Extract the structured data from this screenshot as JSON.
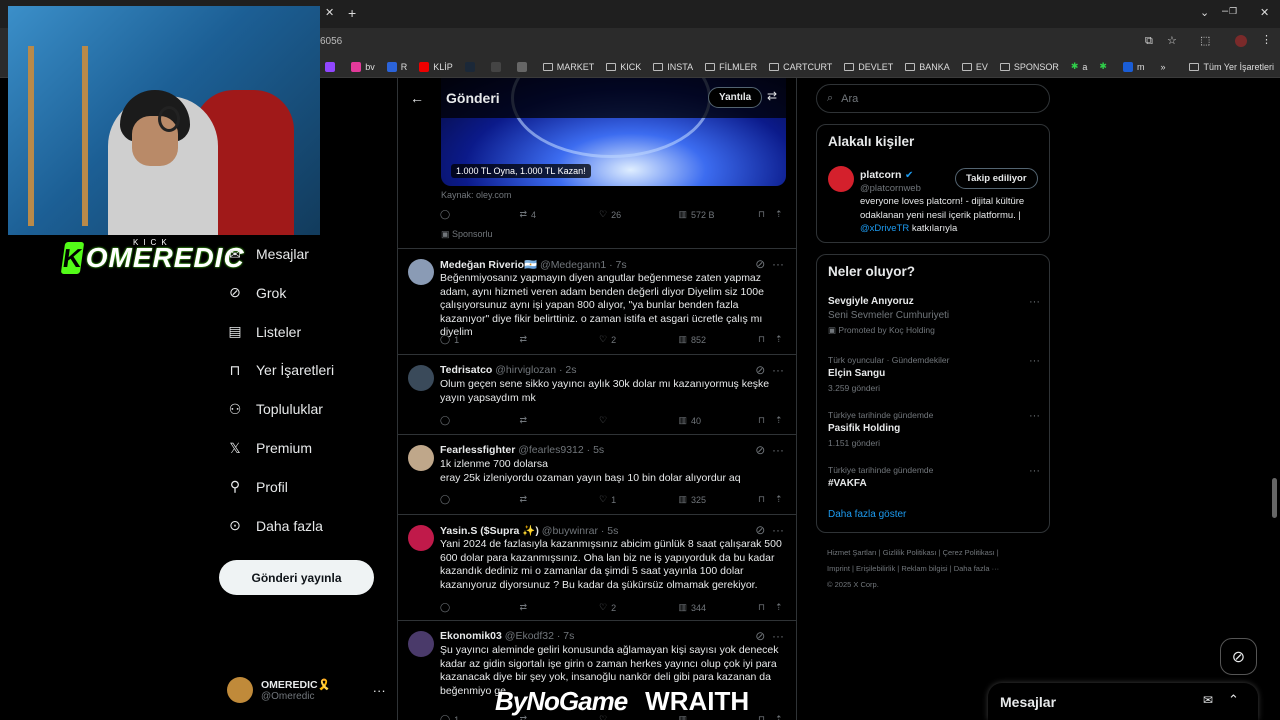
{
  "browser": {
    "address_text": "6056",
    "bookmarks": [
      {
        "label": "R",
        "icon": "none"
      },
      {
        "label": "",
        "icon": "purple-square-icon"
      },
      {
        "label": "KL",
        "icon": "star-icon"
      },
      {
        "label": "",
        "icon": "twitch-icon"
      },
      {
        "label": "bv",
        "icon": "pink-icon"
      },
      {
        "label": "R",
        "icon": "blue-circle-icon"
      },
      {
        "label": "KLİP",
        "icon": "youtube-icon"
      },
      {
        "label": "",
        "icon": "steam-icon"
      },
      {
        "label": "",
        "icon": "tile-icon"
      },
      {
        "label": "",
        "icon": "gear-icon"
      },
      {
        "label": "MARKET",
        "icon": "folder-icon"
      },
      {
        "label": "KICK",
        "icon": "folder-icon"
      },
      {
        "label": "INSTA",
        "icon": "folder-icon"
      },
      {
        "label": "FİLMLER",
        "icon": "folder-icon"
      },
      {
        "label": "CARTCURT",
        "icon": "folder-icon"
      },
      {
        "label": "DEVLET",
        "icon": "folder-icon"
      },
      {
        "label": "BANKA",
        "icon": "folder-icon"
      },
      {
        "label": "EV",
        "icon": "folder-icon"
      },
      {
        "label": "SPONSOR",
        "icon": "folder-icon"
      },
      {
        "label": "a",
        "icon": "green-star-icon"
      },
      {
        "label": "",
        "icon": "green-star-icon"
      },
      {
        "label": "m",
        "icon": "blue-m-icon"
      }
    ],
    "more_label": "»",
    "all_bookmarks": "Tüm Yer İşaretleri"
  },
  "overlay": {
    "kick_small": "KICK",
    "kick_channel": "OMEREDIC",
    "sponsors": [
      "ByNoGame",
      "WRAITH"
    ]
  },
  "nav": {
    "items": [
      {
        "label": "Mesajlar",
        "icon": "mail-icon"
      },
      {
        "label": "Grok",
        "icon": "grok-icon"
      },
      {
        "label": "Listeler",
        "icon": "list-icon"
      },
      {
        "label": "Yer İşaretleri",
        "icon": "bookmark-icon"
      },
      {
        "label": "Topluluklar",
        "icon": "communities-icon"
      },
      {
        "label": "Premium",
        "icon": "x-logo-icon"
      },
      {
        "label": "Profil",
        "icon": "person-icon"
      },
      {
        "label": "Daha fazla",
        "icon": "more-circle-icon"
      }
    ],
    "post_button": "Gönderi yayınla",
    "user_name": "OMEREDIC🎗️",
    "user_handle": "@Omeredic"
  },
  "main": {
    "title": "Gönderi",
    "reply_button": "Yantıla",
    "ad": {
      "caption": "1.000 TL Oyna, 1.000 TL Kazan!",
      "source": "Kaynak: oley.com",
      "stats": {
        "reposts": "4",
        "likes": "26",
        "views": "572 B"
      },
      "sponsored": "Sponsorlu"
    },
    "tweets": [
      {
        "name": "Medeğan Riverio🇦🇷",
        "handle": "@Medegann1 · 7s",
        "text": "Beğenmiyosanız yapmayın diyen angutlar beğenmese zaten yapmaz adam, aynı hizmeti veren adam benden değerli diyor Diyelim siz 100e çalışıyorsunuz aynı işi yapan 800 alıyor, \"ya bunlar benden fazla kazanıyor\" diye fikir belirttiniz. o zaman istifa et asgari ücretle çalış mı diyelim",
        "replies": "1",
        "reposts": "",
        "likes": "2",
        "views": "852"
      },
      {
        "name": "Tedrisatco",
        "handle": "@hirviglozan · 2s",
        "text": "Olum geçen sene sikko yayıncı aylık 30k dolar mı kazanıyormuş keşke yayın yapsaydım mk",
        "replies": "",
        "reposts": "",
        "likes": "",
        "views": "40"
      },
      {
        "name": "Fearlessfighter",
        "handle": "@fearles9312 · 5s",
        "text": "1k izlenme 700 dolarsa\neray 25k izleniyordu ozaman yayın başı 10 bin dolar alıyordur aq",
        "replies": "",
        "reposts": "",
        "likes": "1",
        "views": "325"
      },
      {
        "name": "Yasin.S ($Supra ✨)",
        "handle": "@buywinrar · 5s",
        "text": "Yani 2024 de fazlasıyla kazanmışsınız abicim günlük 8 saat çalışarak 500 600 dolar para kazanmışsınız. Oha lan biz ne iş yapıyorduk da bu kadar kazandık dediniz mi o zamanlar da şimdi 5 saat yayınla 100 dolar kazanıyoruz diyorsunuz ? Bu kadar da şükürsüz olmamak gerekiyor.",
        "replies": "",
        "reposts": "",
        "likes": "2",
        "views": "344"
      },
      {
        "name": "Ekonomik03",
        "handle": "@Ekodf32 · 7s",
        "text": "Şu yayıncı aleminde geliri konusunda ağlamayan kişi sayısı yok denecek kadar az  gidin sigortalı işe girin o zaman herkes yayıncı olup çok iyi para kazanacak diye bir şey yok, insanoğlu nankör deli gibi para kazanan da beğenmiyo ge",
        "replies": "1",
        "reposts": "",
        "likes": "",
        "views": ""
      }
    ]
  },
  "right": {
    "search_placeholder": "Ara",
    "relevant_title": "Alakalı kişiler",
    "person": {
      "name": "platcorn",
      "handle": "@platcornweb",
      "follow_button": "Takip ediliyor",
      "bio_before": "everyone loves platcorn! - dijital kültüre odaklanan yeni nesil içerik platformu. | ",
      "bio_link": "@xDriveTR",
      "bio_after": " katkılarıyla"
    },
    "trends_title": "Neler oluyor?",
    "trends": [
      {
        "sub": "",
        "title": "Sevgiyle Anıyoruz",
        "count": "Seni Sevmeler Cumhuriyeti",
        "promo": "Promoted by Koç Holding"
      },
      {
        "sub": "Türk oyuncular · Gündemdekiler",
        "title": "Elçin Sangu",
        "count": "3.259 gönderi",
        "promo": ""
      },
      {
        "sub": "Türkiye tarihinde gündemde",
        "title": "Pasifik Holding",
        "count": "1.151 gönderi",
        "promo": ""
      },
      {
        "sub": "Türkiye tarihinde gündemde",
        "title": "#VAKFA",
        "count": "",
        "promo": ""
      }
    ],
    "show_more": "Daha fazla göster",
    "footer_line1": "Hizmet Şartları  |   Gizlilik Politikası  |   Çerez Politikası  |",
    "footer_line2": "Imprint  |   Erişilebilirlik  |   Reklam bilgisi  |   Daha fazla ···",
    "footer_line3": "© 2025 X Corp.",
    "dm_title": "Mesajlar"
  },
  "colors": {
    "accent": "#1d9bf0",
    "kick_green": "#53fc18",
    "background": "#000000"
  }
}
